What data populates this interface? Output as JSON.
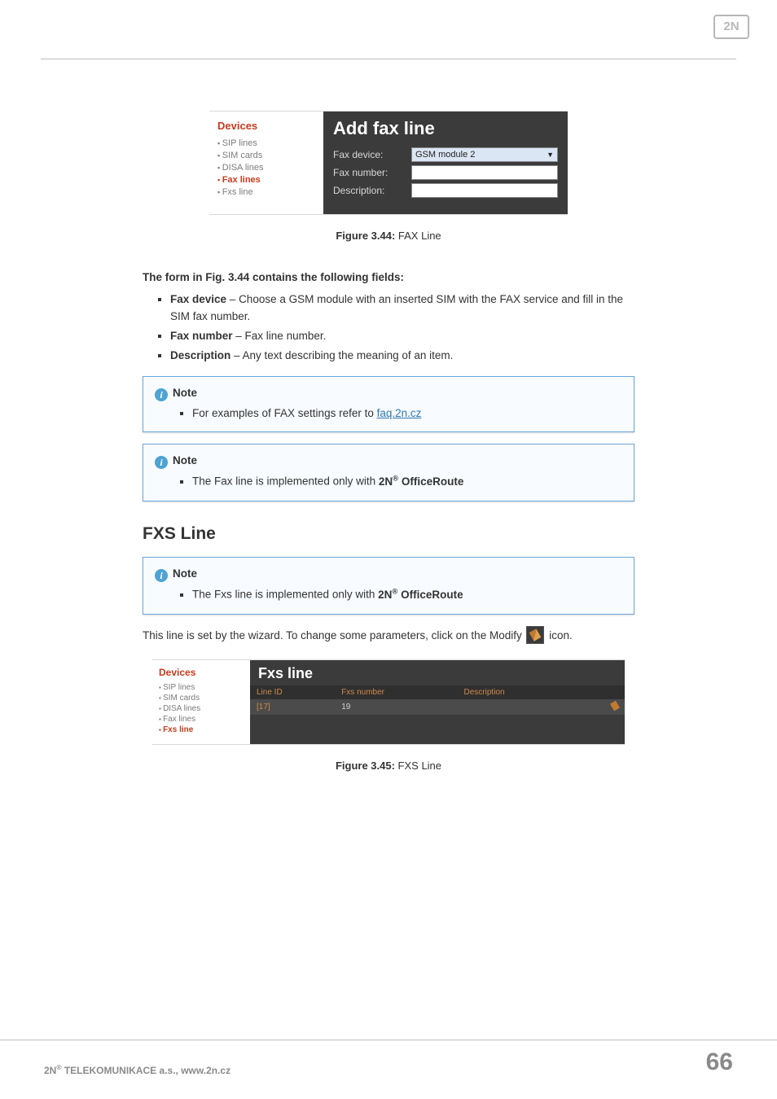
{
  "logo": "2N",
  "fig244": {
    "sidebar_heading": "Devices",
    "sidebar_items": [
      "SIP lines",
      "SIM cards",
      "DISA lines",
      "Fax lines",
      "Fxs line"
    ],
    "sidebar_active_index": 3,
    "panel_title": "Add fax line",
    "rows": {
      "fax_device_label": "Fax device:",
      "fax_device_value": "GSM module 2",
      "fax_number_label": "Fax number:",
      "fax_number_value": "",
      "description_label": "Description:",
      "description_value": ""
    }
  },
  "caption244_label": "Figure 3.44:",
  "caption244_text": " FAX Line",
  "lead": "The form in Fig. 3.44 contains the following fields:",
  "bullets": [
    {
      "term": "Fax device",
      "sep": " – ",
      "desc": "Choose a GSM module with an inserted SIM with the FAX service and fill in the SIM fax number."
    },
    {
      "term": "Fax number",
      "sep": " – ",
      "desc": "Fax line number."
    },
    {
      "term": "Description",
      "sep": " – ",
      "desc": "Any text describing the meaning of an item."
    }
  ],
  "notes": {
    "label": "Note",
    "n1_text": "For examples of FAX settings refer to ",
    "n1_link": "faq.2n.cz",
    "n2_pre": "The Fax line is implemented only with ",
    "n2_brand": "2N",
    "n2_prod": " OfficeRoute",
    "n3_pre": "The Fxs line is implemented only with ",
    "n3_brand": "2N",
    "n3_prod": " OfficeRoute"
  },
  "section_fxs": "FXS Line",
  "para_modify_pre": "This line is set by the wizard. To change some parameters, click on the Modify ",
  "para_modify_post": " icon.",
  "fig245": {
    "sidebar_heading": "Devices",
    "sidebar_items": [
      "SIP lines",
      "SIM cards",
      "DISA lines",
      "Fax lines",
      "Fxs line"
    ],
    "sidebar_active_index": 4,
    "panel_title": "Fxs line",
    "columns": [
      "Line ID",
      "Fxs number",
      "Description",
      ""
    ],
    "row": {
      "line_id": "[17]",
      "fxs_number": "19",
      "description": ""
    }
  },
  "caption245_label": "Figure 3.45:",
  "caption245_text": " FXS Line",
  "footer": {
    "left_brand": "2N",
    "left_rest": " TELEKOMUNIKACE a.s., www.2n.cz",
    "right": "66"
  }
}
